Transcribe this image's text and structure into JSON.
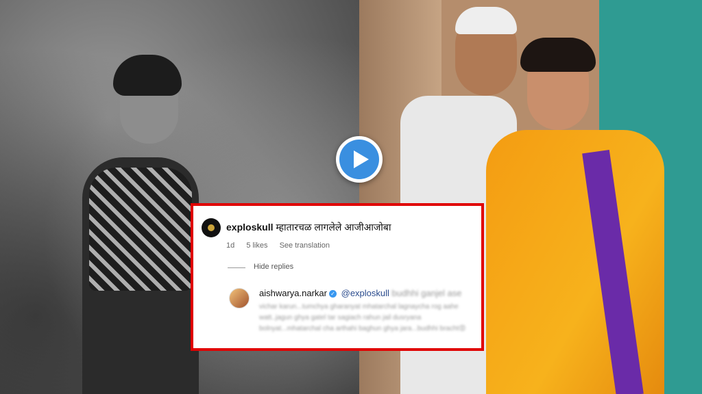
{
  "comment_1": {
    "username": "exploskull",
    "text": "म्हातारचळ लागलेले आजीआजोबा",
    "time": "1d",
    "likes": "5 likes",
    "see_translation": "See translation"
  },
  "hide_replies": "Hide replies",
  "comment_2": {
    "username": "aishwarya.narkar",
    "verified_symbol": "✓",
    "mention": "@exploskull",
    "text_start": "budhhi ganjel ase",
    "text_body": "vichar karun...tumchya gharanyat mhatarchal lagnaycha rog aahe watt..jagun ghya gatel tar sagiach rahun jail dusryana bolnyat...mhatarchal cha arthahi baghun ghya jara...budhhi bracht😡"
  },
  "colors": {
    "highlight_border": "#e00000",
    "play_button": "#3a8fe0",
    "saree": "#f49c12"
  }
}
